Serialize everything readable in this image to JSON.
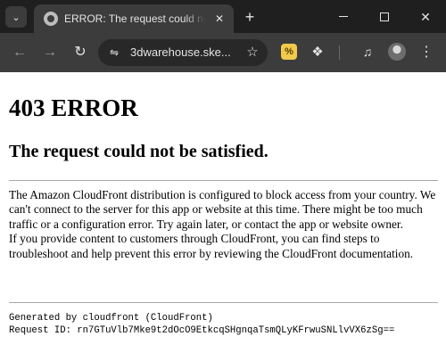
{
  "browser": {
    "tab": {
      "title": "ERROR: The request could not be satisfied",
      "favicon": "globe-icon"
    },
    "address_bar": {
      "url": "3dwarehouse.ske...",
      "site_info_icon": "tune-icon"
    },
    "toolbar_icons": [
      "back-arrow-icon",
      "forward-arrow-icon",
      "reload-icon",
      "bookmark-star-icon",
      "honey-extension-icon",
      "extensions-puzzle-icon",
      "media-control-icon",
      "profile-avatar-icon",
      "kebab-menu-icon"
    ],
    "window_controls": [
      "minimize-icon",
      "maximize-icon",
      "close-icon"
    ],
    "extension_badge": "%"
  },
  "page": {
    "heading": "403 ERROR",
    "subheading": "The request could not be satisfied.",
    "paragraph1": "The Amazon CloudFront distribution is configured to block access from your country. We can't connect to the server for this app or website at this time. There might be too much traffic or a configuration error. Try again later, or contact the app or website owner.",
    "paragraph2": "If you provide content to customers through CloudFront, you can find steps to troubleshoot and help prevent this error by reviewing the CloudFront documentation.",
    "footer_line1": "Generated by cloudfront (CloudFront)",
    "footer_line2": "Request ID: rn7GTuVlb7Mke9t2dOcO9EtkcqSHgnqaTsmQLyKFrwuSNLlvVX6zSg=="
  },
  "colors": {
    "tabstrip_bg": "#1f1f1f",
    "toolbar_bg": "#3c3c3c",
    "omnibox_bg": "#282828",
    "page_bg": "#ffffff",
    "text": "#000000"
  }
}
